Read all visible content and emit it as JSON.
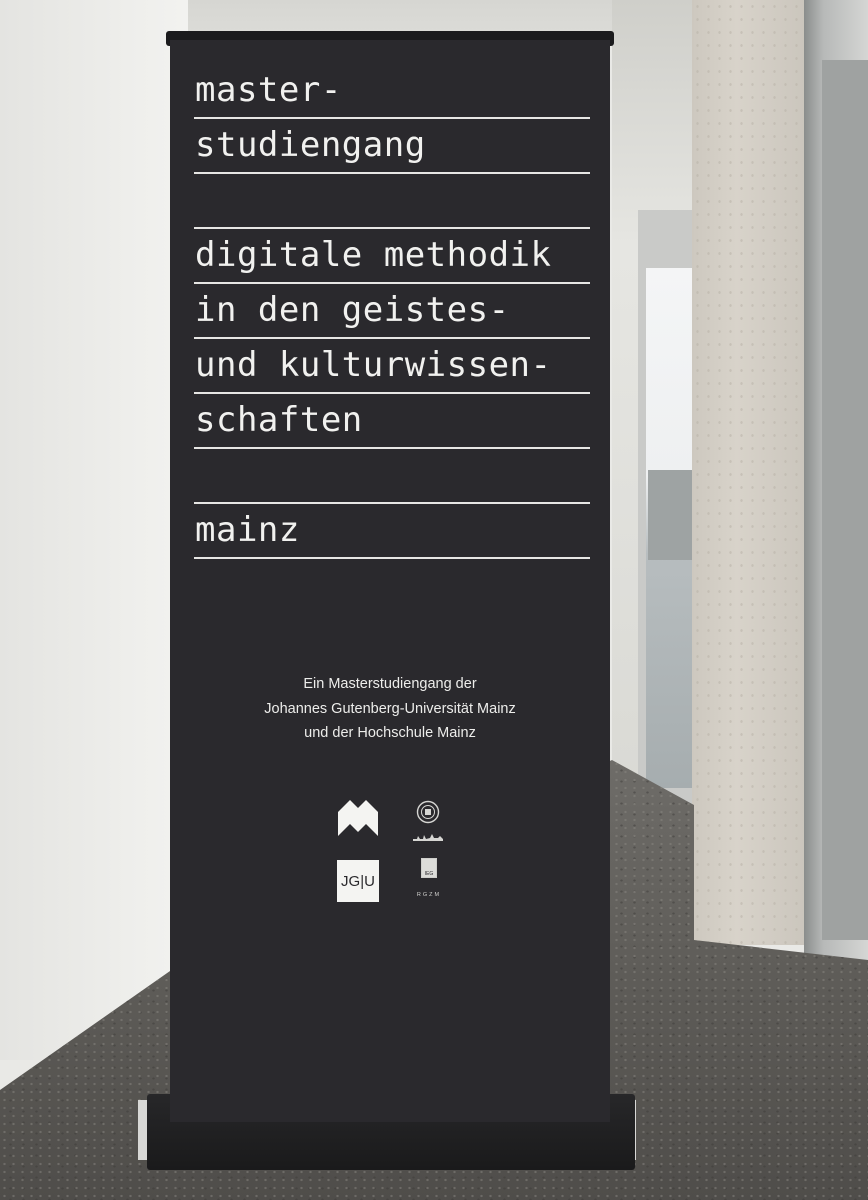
{
  "banner": {
    "title_lines": [
      "master-",
      "studiengang",
      "",
      "digitale methodik",
      "in den geistes-",
      "und kulturwissen-",
      "schaften",
      "",
      "mainz"
    ],
    "credit_lines": [
      "Ein Masterstudiengang der",
      "Johannes Gutenberg-Universität Mainz",
      "und der Hochschule Mainz"
    ],
    "logos": {
      "jgu": "JG|U",
      "ieg": "IEG",
      "rgzm": "RGZM"
    }
  },
  "colors": {
    "banner": "#2a292d",
    "text": "#f1f1ef",
    "wall": "#efefec",
    "floor": "#5e5c58"
  }
}
